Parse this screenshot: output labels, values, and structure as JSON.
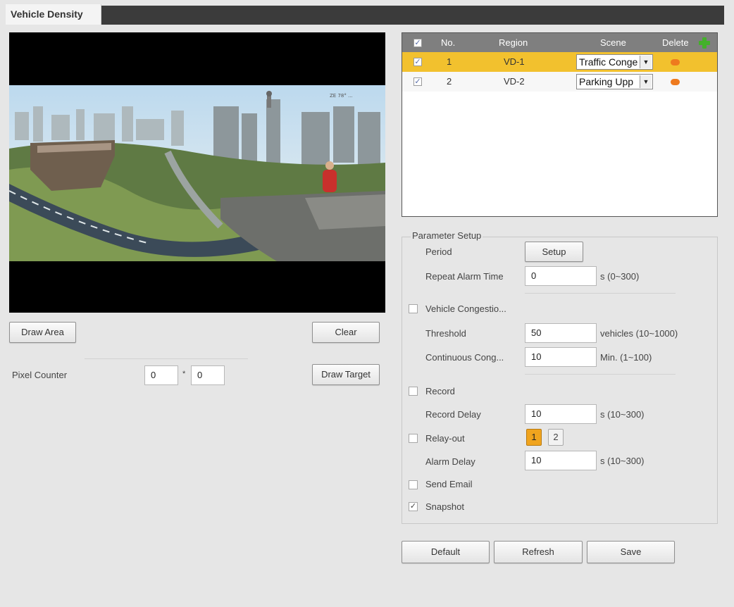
{
  "tab": {
    "title": "Vehicle Density"
  },
  "video": {
    "watermark": "ZE 78° ..."
  },
  "buttons": {
    "draw_area": "Draw Area",
    "clear": "Clear",
    "draw_target": "Draw Target",
    "setup": "Setup",
    "default": "Default",
    "refresh": "Refresh",
    "save": "Save"
  },
  "pixel_counter": {
    "label": "Pixel Counter",
    "width": "0",
    "separator": "*",
    "height": "0"
  },
  "region_table": {
    "columns": {
      "no": "No.",
      "region": "Region",
      "scene": "Scene",
      "delete": "Delete"
    },
    "header_checked": true,
    "rows": [
      {
        "checked": true,
        "no": "1",
        "region": "VD-1",
        "scene": "Traffic Conge",
        "selected": true
      },
      {
        "checked": true,
        "no": "2",
        "region": "VD-2",
        "scene": "Parking Upp",
        "selected": false
      }
    ]
  },
  "params": {
    "legend": "Parameter Setup",
    "period_label": "Period",
    "repeat_alarm_label": "Repeat Alarm Time",
    "repeat_alarm_value": "0",
    "repeat_alarm_unit": "s (0~300)",
    "vehicle_congestion_label": "Vehicle Congestio...",
    "vehicle_congestion_checked": false,
    "threshold_label": "Threshold",
    "threshold_value": "50",
    "threshold_unit": "vehicles (10~1000)",
    "continuous_label": "Continuous Cong...",
    "continuous_value": "10",
    "continuous_unit": "Min. (1~100)",
    "record_label": "Record",
    "record_checked": false,
    "record_delay_label": "Record Delay",
    "record_delay_value": "10",
    "record_delay_unit": "s (10~300)",
    "relay_label": "Relay-out",
    "relay_checked": false,
    "relay_1": "1",
    "relay_2": "2",
    "alarm_delay_label": "Alarm Delay",
    "alarm_delay_value": "10",
    "alarm_delay_unit": "s (10~300)",
    "send_email_label": "Send Email",
    "send_email_checked": false,
    "snapshot_label": "Snapshot",
    "snapshot_checked": true
  },
  "colors": {
    "selected_row": "#f2c12e",
    "relay_active": "#f0a41e",
    "delete_icon": "#ee7a1e",
    "add_icon": "#43b02a",
    "header_bar": "#3b3b3b"
  },
  "icons": {
    "add": "plus-icon",
    "delete": "minus-circle-icon",
    "checkmark": "check-icon",
    "dropdown": "dropdown-arrow-icon"
  }
}
